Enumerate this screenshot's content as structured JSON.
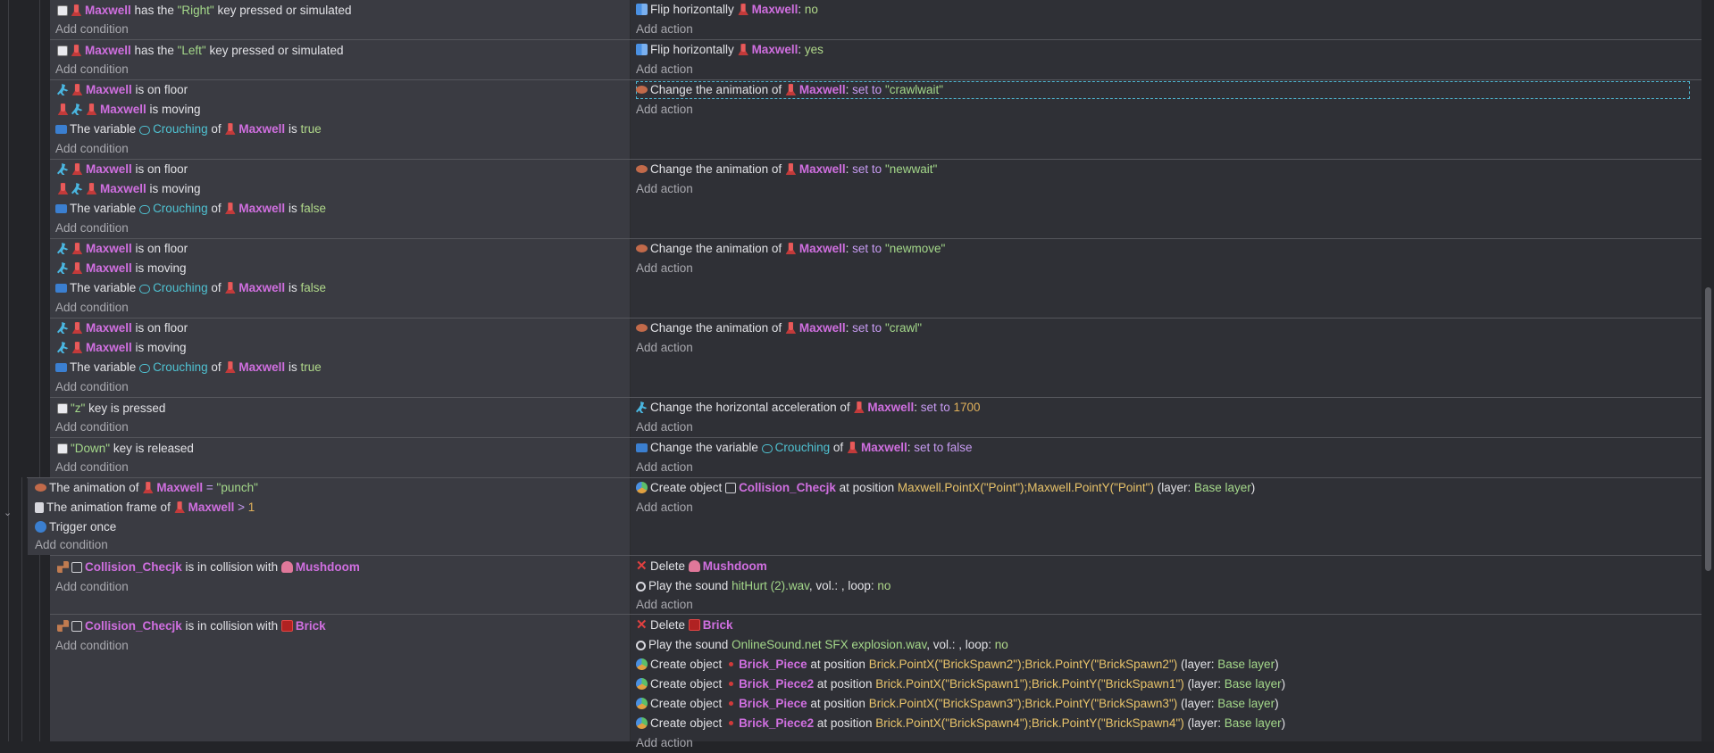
{
  "obj": {
    "maxwell": "Maxwell",
    "collision": "Collision_Checjk",
    "mushdoom": "Mushdoom",
    "brick": "Brick",
    "brick_piece": "Brick_Piece",
    "brick_piece2": "Brick_Piece2"
  },
  "text": {
    "add_condition": "Add condition",
    "add_action": "Add action",
    "has_the": "has the",
    "key_pressed_sim": "key pressed or simulated",
    "right_key": "\"Right\"",
    "left_key": "\"Left\"",
    "flip": "Flip horizontally",
    "no": "no",
    "yes": "yes",
    "is_on_floor": "is on floor",
    "is_moving": "is moving",
    "the_variable": "The variable",
    "crouching": "Crouching",
    "of": "of",
    "is": "is",
    "true": "true",
    "false": "false",
    "change_anim": "Change the animation of",
    "set_to": "set to",
    "anim_crawlwait": "\"crawlwait\"",
    "anim_newwait": "\"newwait\"",
    "anim_newmove": "\"newmove\"",
    "anim_crawl": "\"crawl\"",
    "z_key": "\"z\"",
    "key_is_pressed": "key is pressed",
    "change_haccel": "Change the horizontal acceleration of",
    "haccel_value": "1700",
    "down_key": "\"Down\"",
    "key_is_released": "key is released",
    "change_variable": "Change the variable",
    "set_to_false": "set to false",
    "animation_of": "The animation of",
    "equals": "=",
    "punch": "\"punch\"",
    "anim_frame_of": "The animation frame of",
    "gt": ">",
    "one": "1",
    "trigger_once": "Trigger once",
    "create_object": "Create object",
    "at_position": "at position",
    "layer_open": "(layer:",
    "base_layer": "Base layer",
    "layer_close": ")",
    "point_expr": "Maxwell.PointX(\"Point\");Maxwell.PointY(\"Point\")",
    "in_collision": "is in collision with",
    "delete": "Delete",
    "play_sound": "Play the sound",
    "sound_hurt": "hitHurt (2).wav",
    "sound_explosion": "OnlineSound.net SFX explosion.wav",
    "vol_loop": ", vol.: , loop:",
    "expr_spawn2": "Brick.PointX(\"BrickSpawn2\");Brick.PointY(\"BrickSpawn2\")",
    "expr_spawn1": "Brick.PointX(\"BrickSpawn1\");Brick.PointY(\"BrickSpawn1\")",
    "expr_spawn3": "Brick.PointX(\"BrickSpawn3\");Brick.PointY(\"BrickSpawn3\")",
    "expr_spawn4": "Brick.PointX(\"BrickSpawn4\");Brick.PointY(\"BrickSpawn4\")"
  }
}
